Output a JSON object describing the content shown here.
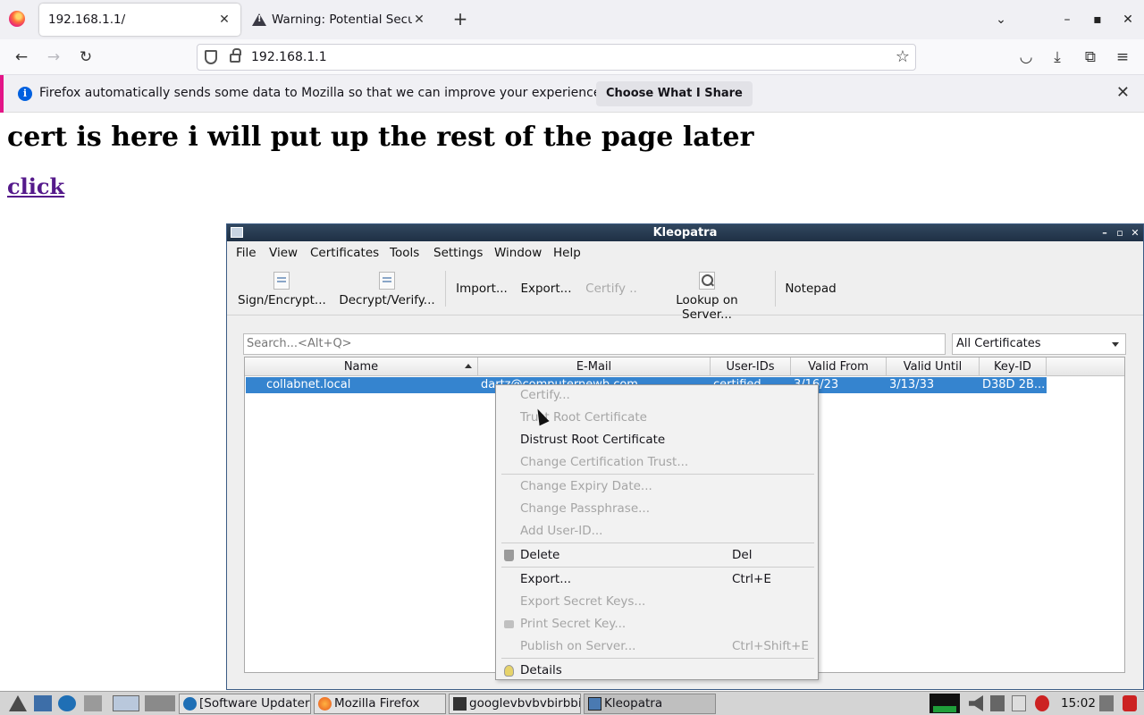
{
  "browser": {
    "tabs": [
      {
        "title": "192.168.1.1/",
        "active": true
      },
      {
        "title": "Warning: Potential Security Risk Ahead",
        "active": false
      }
    ],
    "url": "192.168.1.1",
    "infobar": {
      "message": "Firefox automatically sends some data to Mozilla so that we can improve your experience.",
      "button": "Choose What I Share"
    }
  },
  "page": {
    "heading": "cert is here i will put up the rest of the page later",
    "link": "click"
  },
  "kleopatra": {
    "title": "Kleopatra",
    "menu": [
      "File",
      "View",
      "Certificates",
      "Tools",
      "Settings",
      "Window",
      "Help"
    ],
    "toolbar": {
      "sign": "Sign/Encrypt...",
      "decrypt": "Decrypt/Verify...",
      "import": "Import...",
      "export": "Export...",
      "certify": "Certify ..",
      "lookup": "Lookup on Server...",
      "notepad": "Notepad"
    },
    "search_placeholder": "Search...<Alt+Q>",
    "filter": "All Certificates",
    "columns": [
      "Name",
      "E-Mail",
      "User-IDs",
      "Valid From",
      "Valid Until",
      "Key-ID"
    ],
    "row": {
      "name": "collabnet.local",
      "email": "dartz@computernewb.com",
      "user_ids": "certified",
      "valid_from": "3/16/23",
      "valid_until": "3/13/33",
      "key_id": "D38D 2B..."
    }
  },
  "context_menu": {
    "items": [
      {
        "label": "Certify...",
        "shortcut": "",
        "enabled": false
      },
      {
        "label": "Trust Root Certificate",
        "shortcut": "",
        "enabled": false
      },
      {
        "label": "Distrust Root Certificate",
        "shortcut": "",
        "enabled": true
      },
      {
        "label": "Change Certification Trust...",
        "shortcut": "",
        "enabled": false
      },
      {
        "label": "Change Expiry Date...",
        "shortcut": "",
        "enabled": false
      },
      {
        "label": "Change Passphrase...",
        "shortcut": "",
        "enabled": false
      },
      {
        "label": "Add User-ID...",
        "shortcut": "",
        "enabled": false
      },
      {
        "label": "Delete",
        "shortcut": "Del",
        "enabled": true,
        "icon": "trash-icon"
      },
      {
        "label": "Export...",
        "shortcut": "Ctrl+E",
        "enabled": true
      },
      {
        "label": "Export Secret Keys...",
        "shortcut": "",
        "enabled": false
      },
      {
        "label": "Print Secret Key...",
        "shortcut": "",
        "enabled": false,
        "icon": "printer-icon"
      },
      {
        "label": "Publish on Server...",
        "shortcut": "Ctrl+Shift+E",
        "enabled": false
      },
      {
        "label": "Details",
        "shortcut": "",
        "enabled": true,
        "icon": "lightbulb-icon"
      }
    ]
  },
  "taskbar": {
    "tasks": [
      "[Software Updater]",
      "Mozilla Firefox",
      "googlevbvbvbirbbirbbirb",
      "Kleopatra"
    ],
    "clock": "15:02"
  }
}
